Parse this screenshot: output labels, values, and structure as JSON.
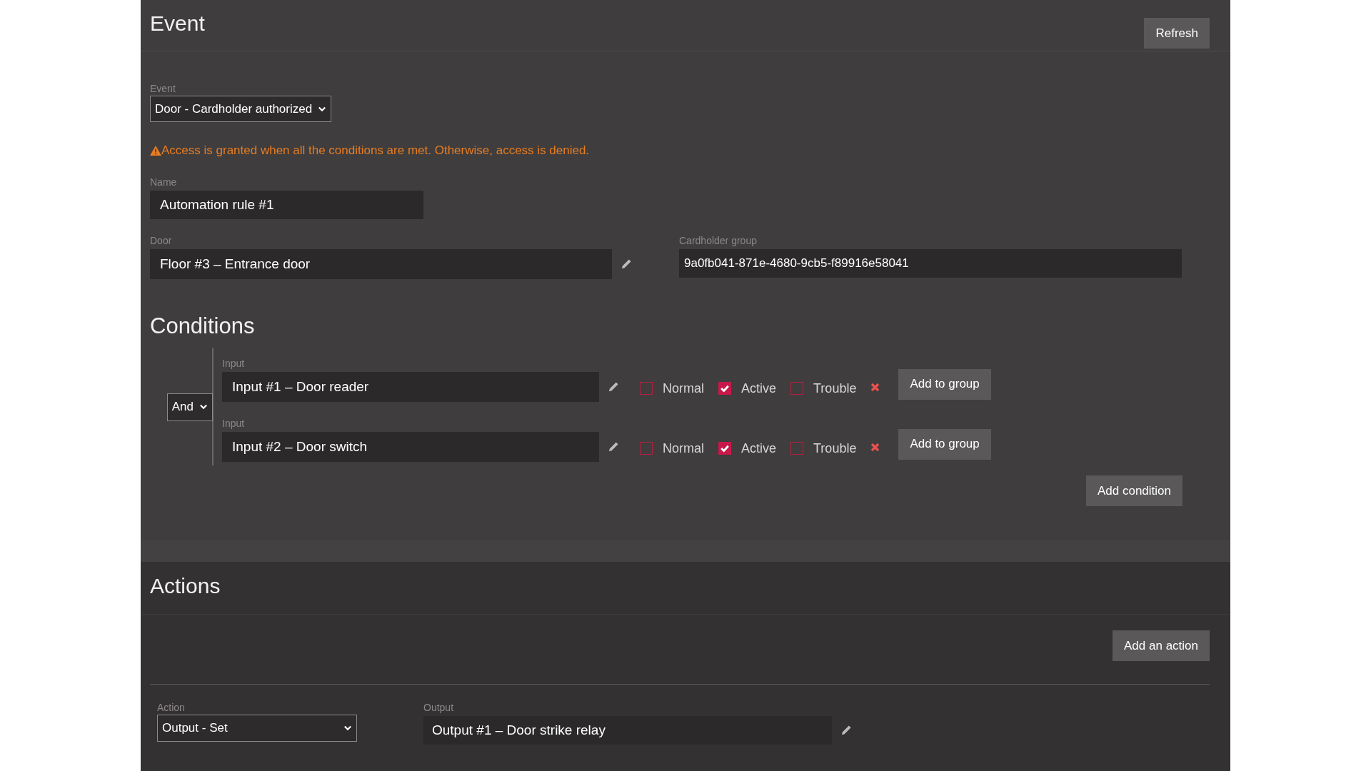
{
  "event_section": {
    "title": "Event",
    "refresh_button": "Refresh",
    "event_field": {
      "label": "Event",
      "value": "Door - Cardholder authorized"
    },
    "warning": "Access is granted when all the conditions are met. Otherwise, access is denied.",
    "name_field": {
      "label": "Name",
      "value": "Automation rule #1"
    },
    "door_field": {
      "label": "Door",
      "value": "Floor #3 – Entrance door"
    },
    "cardholder_group_field": {
      "label": "Cardholder group",
      "value": "9a0fb041-871e-4680-9cb5-f89916e58041"
    }
  },
  "conditions": {
    "title": "Conditions",
    "operator": "And",
    "items": [
      {
        "label": "Input",
        "value": "Input #1 – Door reader",
        "states": [
          {
            "label": "Normal",
            "checked": false
          },
          {
            "label": "Active",
            "checked": true
          },
          {
            "label": "Trouble",
            "checked": false
          }
        ],
        "add_to_group_button": "Add to group"
      },
      {
        "label": "Input",
        "value": "Input #2 – Door switch",
        "states": [
          {
            "label": "Normal",
            "checked": false
          },
          {
            "label": "Active",
            "checked": true
          },
          {
            "label": "Trouble",
            "checked": false
          }
        ],
        "add_to_group_button": "Add to group"
      }
    ],
    "add_condition_button": "Add condition"
  },
  "actions": {
    "title": "Actions",
    "add_action_button": "Add an action",
    "items": [
      {
        "action_field": {
          "label": "Action",
          "value": "Output - Set"
        },
        "output_field": {
          "label": "Output",
          "value": "Output #1 – Door strike relay"
        }
      }
    ]
  }
}
